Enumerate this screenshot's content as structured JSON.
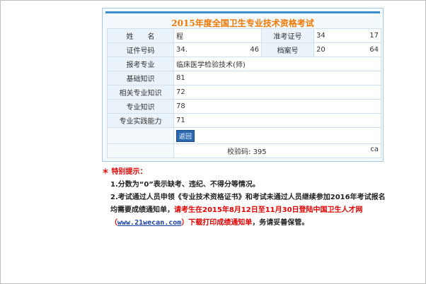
{
  "title": "2015年度全国卫生专业技术资格考试",
  "rows": {
    "name": {
      "label": "姓　　名",
      "value": "程"
    },
    "exam_no": {
      "label": "准考证号",
      "value_a": "34",
      "value_b": "17"
    },
    "id_no": {
      "label": "证件号码",
      "value_a": "34.",
      "value_b": "46"
    },
    "file_no": {
      "label": "档案号",
      "value_a": "20",
      "value_b": "64"
    },
    "specialty": {
      "label": "报考专业",
      "value": "临床医学检验技术(师)"
    },
    "basic": {
      "label": "基础知识",
      "value": "81"
    },
    "related": {
      "label": "相关专业知识",
      "value": "72"
    },
    "professional": {
      "label": "专业知识",
      "value": "78"
    },
    "practice": {
      "label": "专业实践能力",
      "value": "71"
    }
  },
  "back_button": "返回",
  "checksum": {
    "label": "校验码:",
    "value": "395",
    "suffix": "ca"
  },
  "notes": {
    "heading": "＊ 特别提示：",
    "item1": "1.分数为“0”表示缺考、违纪、不得分等情况。",
    "item2_black": "2.考试通过人员申领《专业技术资格证书》和考试未通过人员继续参加2016年考试报名均需要成绩通知单，",
    "item2_red_a": "请考生在2015年8月12日至11月30日登陆中国卫生人才网（",
    "item2_link": "www.21wecan.com",
    "item2_red_b": "）下载打印成绩通知单",
    "item2_tail": "，务请妥善保管。"
  }
}
